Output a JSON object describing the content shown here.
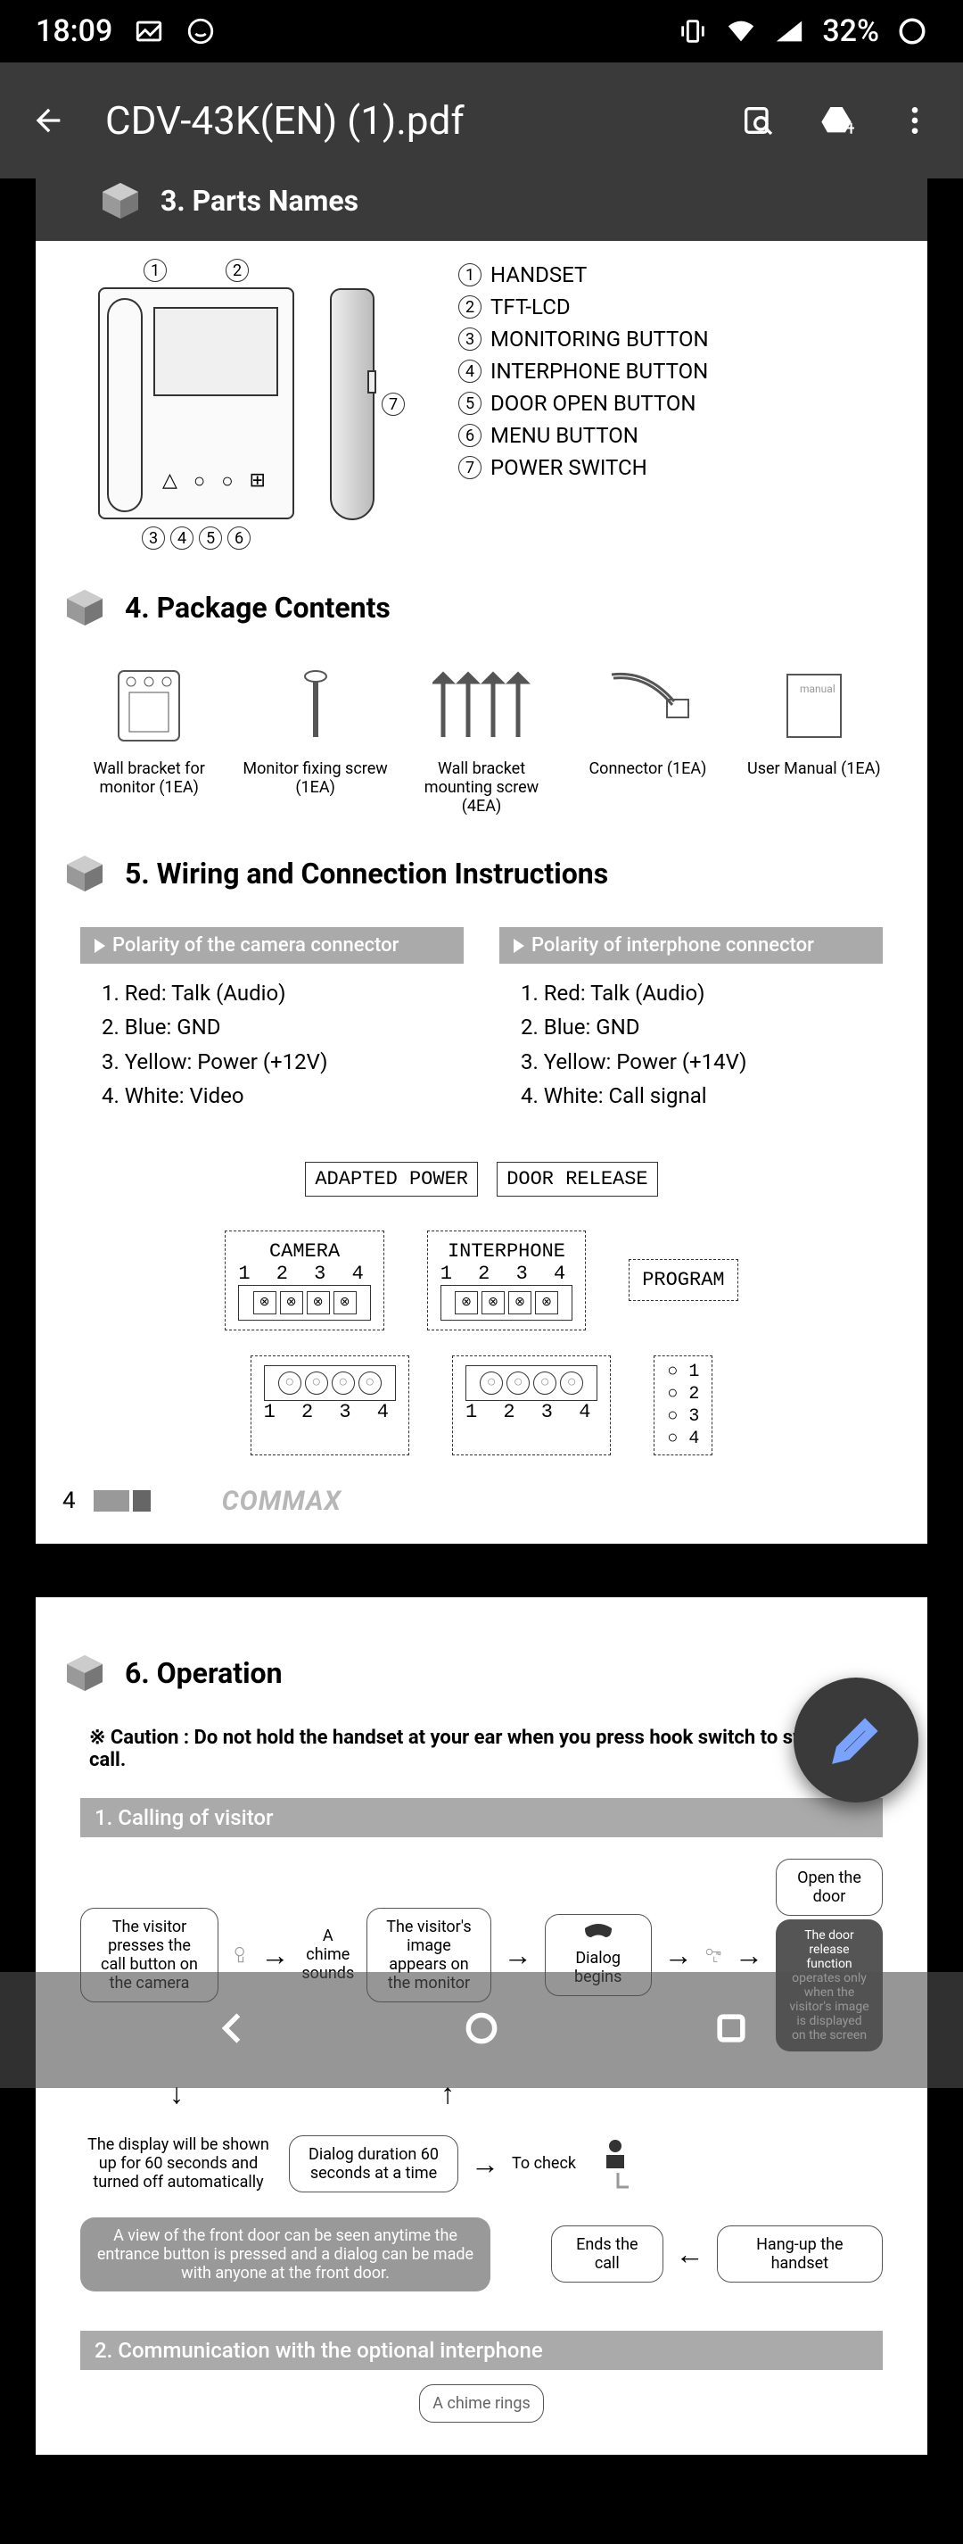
{
  "status": {
    "time": "18:09",
    "battery": "32%"
  },
  "appbar": {
    "title": "CDV-43K(EN) (1).pdf"
  },
  "doc": {
    "section3_title": "3. Parts Names",
    "parts": [
      "HANDSET",
      "TFT-LCD",
      "MONITORING BUTTON",
      "INTERPHONE BUTTON",
      "DOOR OPEN BUTTON",
      "MENU BUTTON",
      "POWER SWITCH"
    ],
    "section4_title": "4. Package Contents",
    "package": [
      "Wall bracket for monitor (1EA)",
      "Monitor fixing screw (1EA)",
      "Wall bracket mounting screw (4EA)",
      "Connector (1EA)",
      "User Manual (1EA)"
    ],
    "manual_label": "manual",
    "section5_title": "5. Wiring and Connection Instructions",
    "polarity_camera_title": "Polarity of the camera connector",
    "polarity_camera": [
      "1. Red: Talk (Audio)",
      "2. Blue: GND",
      "3. Yellow: Power (+12V)",
      "4. White: Video"
    ],
    "polarity_interphone_title": "Polarity of interphone connector",
    "polarity_interphone": [
      "1. Red: Talk (Audio)",
      "2. Blue: GND",
      "3. Yellow: Power (+14V)",
      "4. White: Call signal"
    ],
    "wiring": {
      "adapted_power": "ADAPTED POWER",
      "door_release": "DOOR RELEASE",
      "camera": "CAMERA",
      "interphone": "INTERPHONE",
      "program": "PROGRAM",
      "pins": "1  2  3  4"
    },
    "page_number": "4",
    "brand": "COMMAX",
    "section6_title": "6. Operation",
    "caution": "※ Caution : Do not hold the handset at your ear when you press hook switch to switch call.",
    "op_sub1": "1. Calling of visitor",
    "flow": {
      "box1": "The visitor presses the call button on the camera",
      "chime": "A chime sounds",
      "box2": "The visitor's image appears on the monitor",
      "box3": "Dialog begins",
      "box4": "Open the door",
      "box4b": "The door release function operates only when the visitor's image is displayed on the screen",
      "box5": "The display will be shown up for 60 seconds and turned off automatically",
      "box6": "Dialog duration 60 seconds at a time",
      "box7": "To check",
      "box8": "A view of the front door can be seen anytime the entrance button is pressed and a dialog can be made with anyone at the front door.",
      "box9": "Ends the call",
      "box10": "Hang-up the handset"
    },
    "op_sub2": "2. Communication with the optional interphone",
    "chime_rings": "A chime rings"
  }
}
